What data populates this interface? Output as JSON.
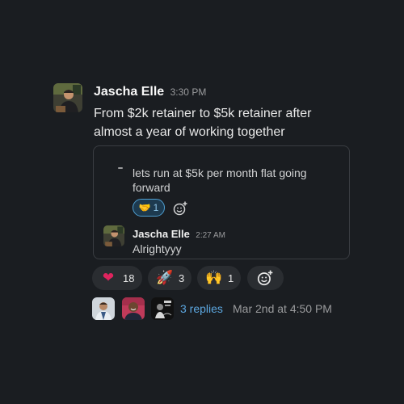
{
  "message": {
    "author": "Jascha Elle",
    "time": "3:30 PM",
    "text": "From $2k retainer to $5k retainer after almost a year of working together"
  },
  "quoted": {
    "text": "lets run at $5k per month flat going forward",
    "reaction": {
      "emoji": "🤝",
      "emoji_name": "handshake-emoji",
      "count": "1",
      "selected": true
    },
    "reply": {
      "author": "Jascha Elle",
      "time": "2:27 AM",
      "text": "Alrightyyy"
    }
  },
  "reactions": [
    {
      "emoji": "❤",
      "emoji_name": "red-heart-emoji",
      "count": "18"
    },
    {
      "emoji": "🚀",
      "emoji_name": "rocket-emoji",
      "count": "3"
    },
    {
      "emoji": "🙌",
      "emoji_name": "raised-hands-emoji",
      "count": "1"
    }
  ],
  "add_reaction_icon": "add-emoji-icon",
  "thread": {
    "replies": "3 replies",
    "last_reply": "Mar 2nd at 4:50 PM"
  },
  "colors": {
    "background": "#1a1d21",
    "link": "#5ca7e0",
    "selected_reaction_border": "#4f9fd1"
  }
}
